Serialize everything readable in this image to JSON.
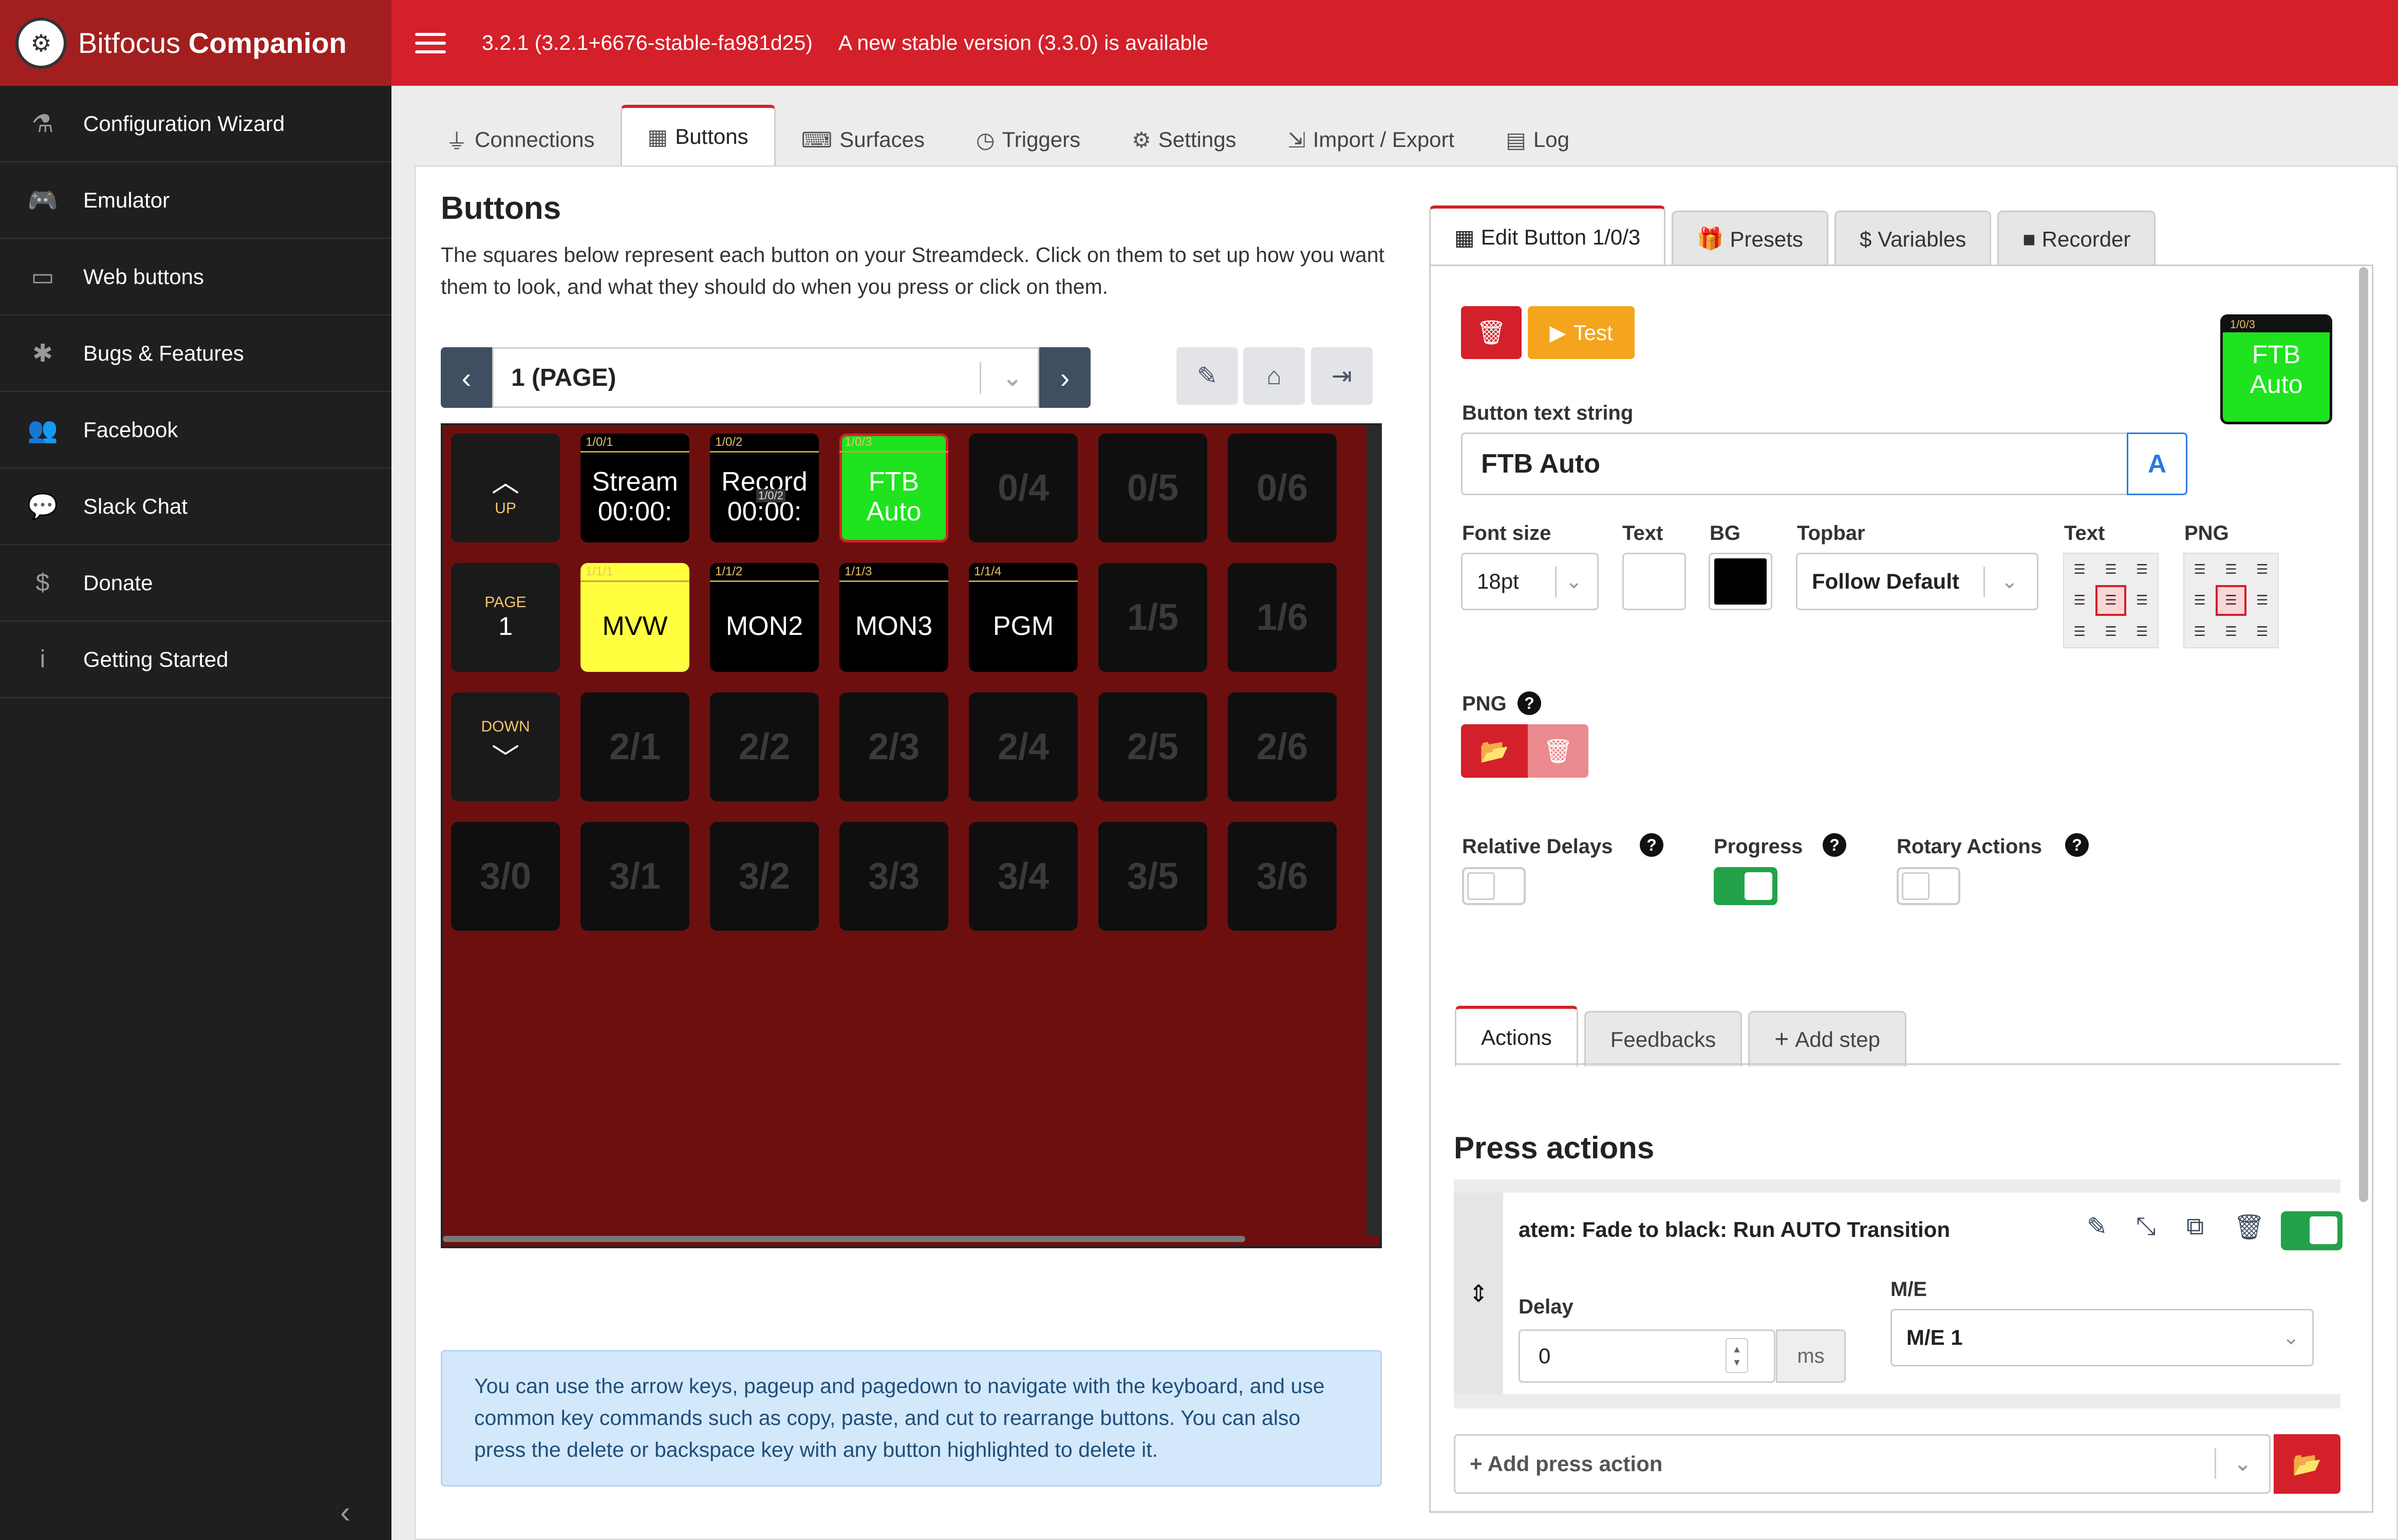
{
  "app": {
    "logo_glyph": "⚙",
    "brand_prefix": "Bitfocus",
    "brand_name": "Companion",
    "version": "3.2.1 (3.2.1+6676-stable-fa981d25)",
    "update_notice": "A new stable version (3.3.0) is available"
  },
  "colors": {
    "accent": "#d3202a",
    "sidebar": "#1f1f1f",
    "green": "#23a24a",
    "warning": "#f4a51d"
  },
  "sidebar": {
    "items": [
      {
        "label": "Configuration Wizard",
        "icon": "wizard-hat-icon",
        "glyph": "⚗"
      },
      {
        "label": "Emulator",
        "icon": "gamepad-icon",
        "glyph": "🎮"
      },
      {
        "label": "Web buttons",
        "icon": "tablet-icon",
        "glyph": "▭"
      },
      {
        "label": "Bugs & Features",
        "icon": "bug-icon",
        "glyph": "✱"
      },
      {
        "label": "Facebook",
        "icon": "users-icon",
        "glyph": "👥"
      },
      {
        "label": "Slack Chat",
        "icon": "comments-icon",
        "glyph": "💬"
      },
      {
        "label": "Donate",
        "icon": "dollar-icon",
        "glyph": "$"
      },
      {
        "label": "Getting Started",
        "icon": "info-icon",
        "glyph": "i"
      }
    ],
    "collapse_glyph": "‹"
  },
  "tabs": [
    {
      "label": "Connections",
      "icon": "plug-icon",
      "glyph": "⏚"
    },
    {
      "label": "Buttons",
      "icon": "calendar-icon",
      "glyph": "▦"
    },
    {
      "label": "Surfaces",
      "icon": "gamepad-icon",
      "glyph": "⌨"
    },
    {
      "label": "Triggers",
      "icon": "clock-icon",
      "glyph": "◷"
    },
    {
      "label": "Settings",
      "icon": "gear-icon",
      "glyph": "⚙"
    },
    {
      "label": "Import / Export",
      "icon": "file-import-icon",
      "glyph": "⇲"
    },
    {
      "label": "Log",
      "icon": "clipboard-icon",
      "glyph": "▤"
    }
  ],
  "buttons_page": {
    "title": "Buttons",
    "description": "The squares below represent each button on your Streamdeck. Click on them to set up how you want them to look, and what they should do when you press or click on them.",
    "page_selector": "1 (PAGE)",
    "prev_glyph": "‹",
    "next_glyph": "›",
    "chevron": "⌄",
    "tool_edit": "✎",
    "tool_home": "⌂",
    "tool_export": "⇥",
    "help_text": "You can use the arrow keys, pageup and pagedown to navigate with the keyboard, and use common key commands such as copy, paste, and cut to rearrange buttons. You can also press the delete or backspace key with any button highlighted to delete it."
  },
  "grid": {
    "nav": {
      "up_glyph": "︿",
      "up_label": "UP",
      "page_label": "PAGE",
      "page_number": "1",
      "down_label": "DOWN",
      "down_glyph": "﹀"
    },
    "rows": [
      [
        {
          "type": "button",
          "id": "1/0/1",
          "label": "Stream\n00:00:",
          "bg": "#000000",
          "fg": "#ffffff"
        },
        {
          "type": "button",
          "id": "1/0/2",
          "label": "Record\n00:00:",
          "bg": "#000000",
          "fg": "#ffffff",
          "overlay": "1/0/2"
        },
        {
          "type": "button",
          "id": "1/0/3",
          "label": "FTB\nAuto",
          "bg": "#1ee31e",
          "fg": "#ffffff",
          "selected": true
        },
        {
          "type": "empty",
          "label": "0/4"
        },
        {
          "type": "empty",
          "label": "0/5"
        },
        {
          "type": "empty",
          "label": "0/6"
        }
      ],
      [
        {
          "type": "button",
          "id": "1/1/1",
          "label": "MVW",
          "bg": "#ffff40",
          "fg": "#000000"
        },
        {
          "type": "button",
          "id": "1/1/2",
          "label": "MON2",
          "bg": "#000000",
          "fg": "#ffffff"
        },
        {
          "type": "button",
          "id": "1/1/3",
          "label": "MON3",
          "bg": "#000000",
          "fg": "#ffffff"
        },
        {
          "type": "button",
          "id": "1/1/4",
          "label": "PGM",
          "bg": "#000000",
          "fg": "#ffffff"
        },
        {
          "type": "empty",
          "label": "1/5"
        },
        {
          "type": "empty",
          "label": "1/6"
        }
      ],
      [
        {
          "type": "empty",
          "label": "2/1"
        },
        {
          "type": "empty",
          "label": "2/2"
        },
        {
          "type": "empty",
          "label": "2/3"
        },
        {
          "type": "empty",
          "label": "2/4"
        },
        {
          "type": "empty",
          "label": "2/5"
        },
        {
          "type": "empty",
          "label": "2/6"
        }
      ],
      [
        {
          "type": "empty",
          "label": "3/0"
        },
        {
          "type": "empty",
          "label": "3/1"
        },
        {
          "type": "empty",
          "label": "3/2"
        },
        {
          "type": "empty",
          "label": "3/3"
        },
        {
          "type": "empty",
          "label": "3/4"
        },
        {
          "type": "empty",
          "label": "3/5"
        },
        {
          "type": "empty",
          "label": "3/6"
        }
      ]
    ]
  },
  "right_tabs": [
    {
      "label": "Edit Button 1/0/3",
      "icon": "calculator-icon",
      "glyph": "▦"
    },
    {
      "label": "Presets",
      "icon": "gift-icon",
      "glyph": "🎁"
    },
    {
      "label": "Variables",
      "icon": "dollar-icon",
      "glyph": "$"
    },
    {
      "label": "Recorder",
      "icon": "video-icon",
      "glyph": "■"
    }
  ],
  "editor": {
    "delete_glyph": "🗑",
    "test_glyph": "▶",
    "test_label": "Test",
    "preview_id": "1/0/3",
    "preview_label": "FTB\nAuto",
    "text_label": "Button text string",
    "text_value": "FTB Auto",
    "expression_glyph": "A",
    "font_size_label": "Font size",
    "font_size_value": "18pt",
    "text_color_label": "Text",
    "text_color": "#ffffff",
    "bg_label": "BG",
    "bg_color": "#000000",
    "topbar_label": "Topbar",
    "topbar_value": "Follow Default",
    "text_align_label": "Text",
    "png_align_label": "PNG",
    "align_glyph": "☰",
    "png_label": "PNG",
    "png_open_glyph": "📂",
    "png_delete_glyph": "🗑",
    "help_glyph": "?",
    "relative_delays_label": "Relative Delays",
    "relative_delays": false,
    "progress_label": "Progress",
    "progress": true,
    "rotary_label": "Rotary Actions",
    "rotary": false
  },
  "action_tabs": [
    {
      "label": "Actions"
    },
    {
      "label": "Feedbacks"
    },
    {
      "label": "Add step",
      "glyph": "+"
    }
  ],
  "press_actions": {
    "heading": "Press actions",
    "items": [
      {
        "name": "atem: Fade to black: Run AUTO Transition",
        "delay_label": "Delay",
        "delay_value": "0",
        "delay_unit": "ms",
        "me_label": "M/E",
        "me_value": "M/E 1",
        "enabled": true
      }
    ],
    "add_placeholder": "+ Add press action",
    "drag_glyph": "⇕",
    "edit_glyph": "✎",
    "collapse_glyph": "⤡",
    "copy_glyph": "⧉",
    "delete_glyph": "🗑",
    "spin_up": "▴",
    "spin_down": "▾"
  }
}
